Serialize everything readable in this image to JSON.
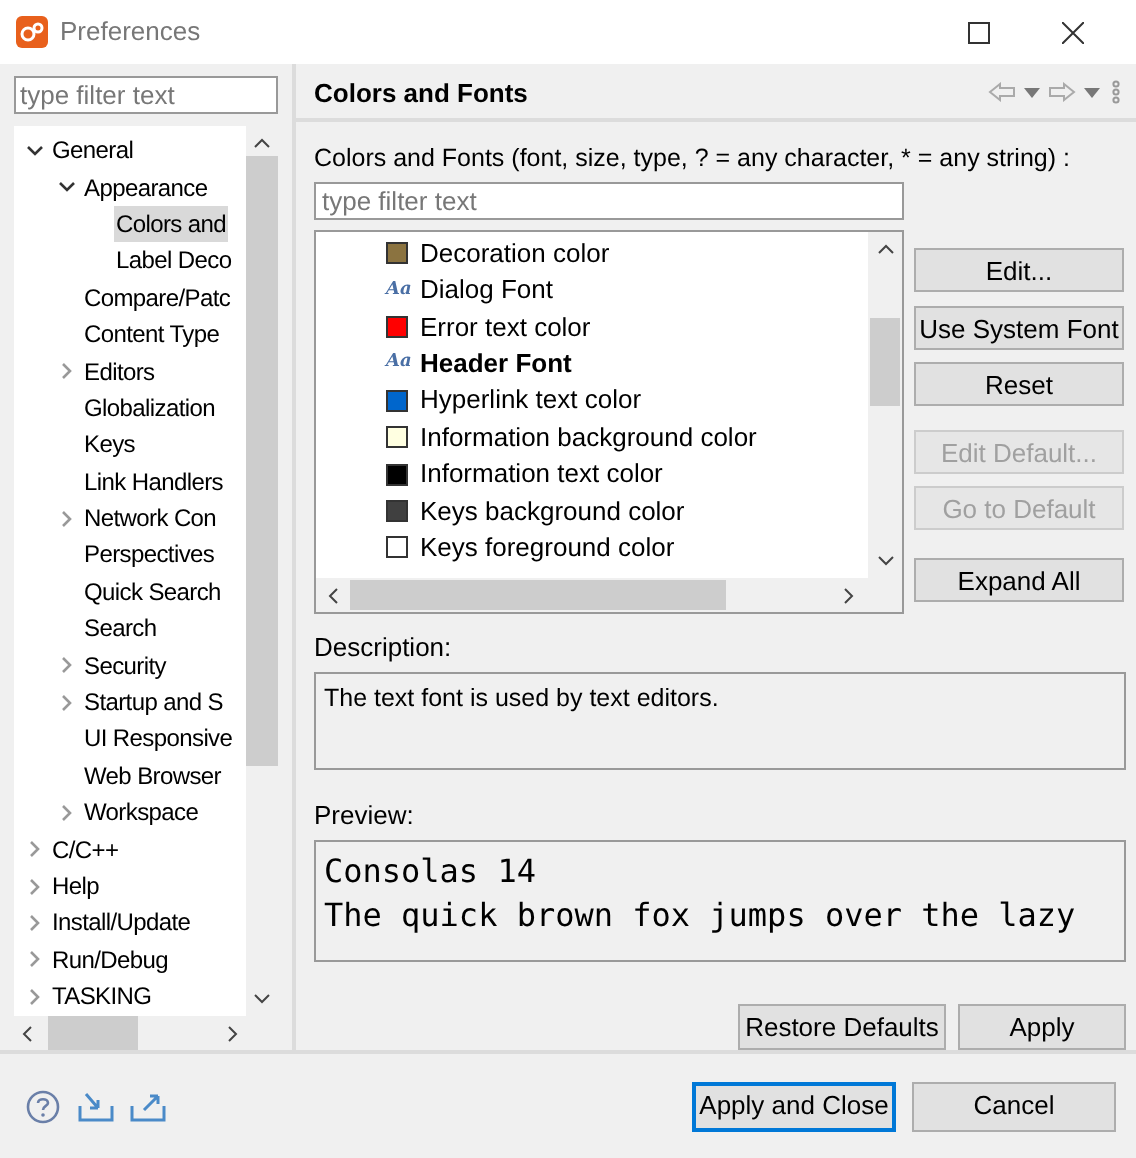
{
  "window": {
    "title": "Preferences"
  },
  "sidebar": {
    "filter_placeholder": "type filter text",
    "tree": [
      {
        "label": "General",
        "expanded": true,
        "children": [
          {
            "label": "Appearance",
            "expanded": true,
            "children": [
              {
                "label": "Colors and",
                "selected": true
              },
              {
                "label": "Label Deco",
                "selected": false
              }
            ]
          },
          {
            "label": "Compare/Patc",
            "selected": false
          },
          {
            "label": "Content Type",
            "selected": false
          },
          {
            "label": "Editors",
            "expanded": false,
            "selected": false
          },
          {
            "label": "Globalization",
            "selected": false
          },
          {
            "label": "Keys",
            "selected": false
          },
          {
            "label": "Link Handlers",
            "selected": false
          },
          {
            "label": "Network Con",
            "expanded": false,
            "selected": false
          },
          {
            "label": "Perspectives",
            "selected": false
          },
          {
            "label": "Quick Search",
            "selected": false
          },
          {
            "label": "Search",
            "selected": false
          },
          {
            "label": "Security",
            "expanded": false,
            "selected": false
          },
          {
            "label": "Startup and S",
            "expanded": false,
            "selected": false
          },
          {
            "label": "UI Responsive",
            "selected": false
          },
          {
            "label": "Web Browser",
            "selected": false
          },
          {
            "label": "Workspace",
            "expanded": false,
            "selected": false
          }
        ]
      },
      {
        "label": "C/C++",
        "expanded": false,
        "selected": false
      },
      {
        "label": "Help",
        "expanded": false,
        "selected": false
      },
      {
        "label": "Install/Update",
        "expanded": false,
        "selected": false
      },
      {
        "label": "Run/Debug",
        "expanded": false,
        "selected": false
      },
      {
        "label": "TASKING",
        "expanded": false,
        "selected": false
      }
    ]
  },
  "page": {
    "title": "Colors and Fonts",
    "filter_label": "Colors and Fonts (font, size, type, ? = any character, * = any string) :",
    "filter_placeholder": "type filter text",
    "items": [
      {
        "kind": "color",
        "label": "Decoration color",
        "color": "#8b7340"
      },
      {
        "kind": "font",
        "label": "Dialog Font",
        "icon": "Aa",
        "bold": false
      },
      {
        "kind": "color",
        "label": "Error text color",
        "color": "#ff0000"
      },
      {
        "kind": "font",
        "label": "Header Font",
        "icon": "Aa",
        "bold": true
      },
      {
        "kind": "color",
        "label": "Hyperlink text color",
        "color": "#0066cc"
      },
      {
        "kind": "color",
        "label": "Information background color",
        "color": "#ffffe1"
      },
      {
        "kind": "color",
        "label": "Information text color",
        "color": "#000000"
      },
      {
        "kind": "color",
        "label": "Keys background color",
        "color": "#404040"
      },
      {
        "kind": "color",
        "label": "Keys foreground color",
        "color": "#ffffff"
      }
    ],
    "buttons": [
      {
        "label": "Edit...",
        "disabled": false
      },
      {
        "label": "Use System Font",
        "disabled": false
      },
      {
        "label": "Reset",
        "disabled": false
      },
      {
        "label": "Edit Default...",
        "disabled": true
      },
      {
        "label": "Go to Default",
        "disabled": true
      },
      {
        "label": "Expand All",
        "disabled": false
      }
    ],
    "description_label": "Description:",
    "description": "The text font is used by text editors.",
    "preview_label": "Preview:",
    "preview_lines": [
      "Consolas 14",
      "The quick brown fox jumps over the lazy"
    ],
    "page_buttons": [
      "Restore Defaults",
      "Apply"
    ]
  },
  "footer_buttons": [
    {
      "label": "Apply and Close",
      "default": true
    },
    {
      "label": "Cancel",
      "default": false
    }
  ]
}
